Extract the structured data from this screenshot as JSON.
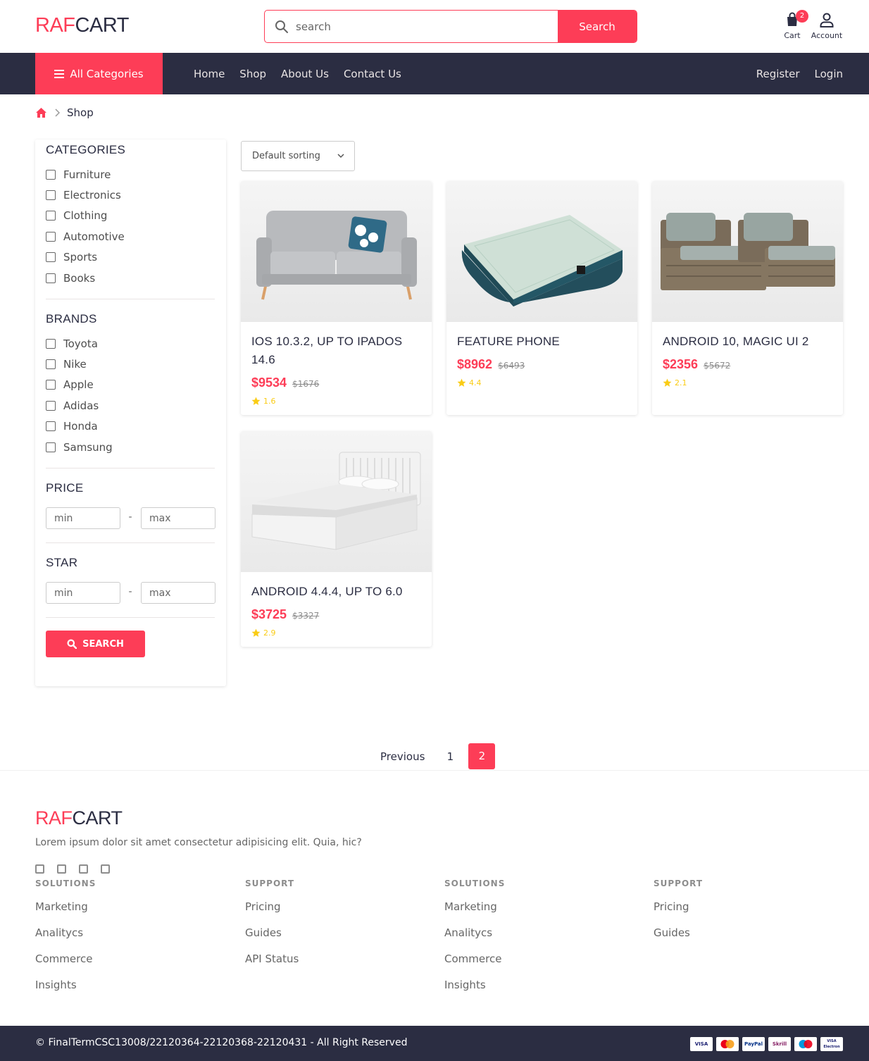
{
  "brand": {
    "part1": "RAF",
    "part2": "CART"
  },
  "search": {
    "placeholder": "search",
    "button": "Search"
  },
  "header": {
    "cart_label": "Cart",
    "cart_count": "2",
    "account_label": "Account"
  },
  "nav": {
    "all_categories": "All Categories",
    "links": [
      "Home",
      "Shop",
      "About Us",
      "Contact Us"
    ],
    "right_links": [
      "Register",
      "Login"
    ]
  },
  "breadcrumb": {
    "current": "Shop"
  },
  "sidebar": {
    "categories_title": "CATEGORIES",
    "categories": [
      "Furniture",
      "Electronics",
      "Clothing",
      "Automotive",
      "Sports",
      "Books"
    ],
    "brands_title": "BRANDS",
    "brands": [
      "Toyota",
      "Nike",
      "Apple",
      "Adidas",
      "Honda",
      "Samsung"
    ],
    "price_title": "PRICE",
    "star_title": "STAR",
    "min_placeholder": "min",
    "max_placeholder": "max",
    "dash": "-",
    "search_button": "SEARCH"
  },
  "sorting": {
    "selected": "Default sorting"
  },
  "products": [
    {
      "name": "IOS 10.3.2, UP TO IPADOS 14.6",
      "price": "$9534",
      "old_price": "$1676",
      "rating": "1.6",
      "image": "sofa"
    },
    {
      "name": "FEATURE PHONE",
      "price": "$8962",
      "old_price": "$6493",
      "rating": "4.4",
      "image": "air-mattress"
    },
    {
      "name": "ANDROID 10, MAGIC UI 2",
      "price": "$2356",
      "old_price": "$5672",
      "rating": "2.1",
      "image": "wicker-chairs"
    },
    {
      "name": "ANDROID 4.4.4, UP TO 6.0",
      "price": "$3725",
      "old_price": "$3327",
      "rating": "2.9",
      "image": "bed"
    }
  ],
  "pagination": {
    "previous": "Previous",
    "pages": [
      "1",
      "2"
    ],
    "current": "2"
  },
  "footer": {
    "brand_part1": "RAF",
    "brand_part2": "CART",
    "description": "Lorem ipsum dolor sit amet consectetur adipisicing elit. Quia, hic?",
    "socials": [
      "facebook-icon",
      "instagram-icon",
      "twitter-icon",
      "github-icon"
    ],
    "columns": [
      {
        "title": "SOLUTIONS",
        "links": [
          "Marketing",
          "Analitycs",
          "Commerce",
          "Insights"
        ]
      },
      {
        "title": "SUPPORT",
        "links": [
          "Pricing",
          "Guides",
          "API Status"
        ]
      },
      {
        "title": "SOLUTIONS",
        "links": [
          "Marketing",
          "Analitycs",
          "Commerce",
          "Insights"
        ]
      },
      {
        "title": "SUPPORT",
        "links": [
          "Pricing",
          "Guides"
        ]
      }
    ],
    "copyright": "© FinalTermCSC13008/22120364-22120368-22120431 - All Right Reserved",
    "payments": [
      "VISA",
      "MasterCard",
      "PayPal",
      "Skrill",
      "Maestro",
      "Visa Electron"
    ]
  },
  "colors": {
    "accent": "#fd3d57",
    "dark": "#2b2d42",
    "star": "#facc15"
  }
}
